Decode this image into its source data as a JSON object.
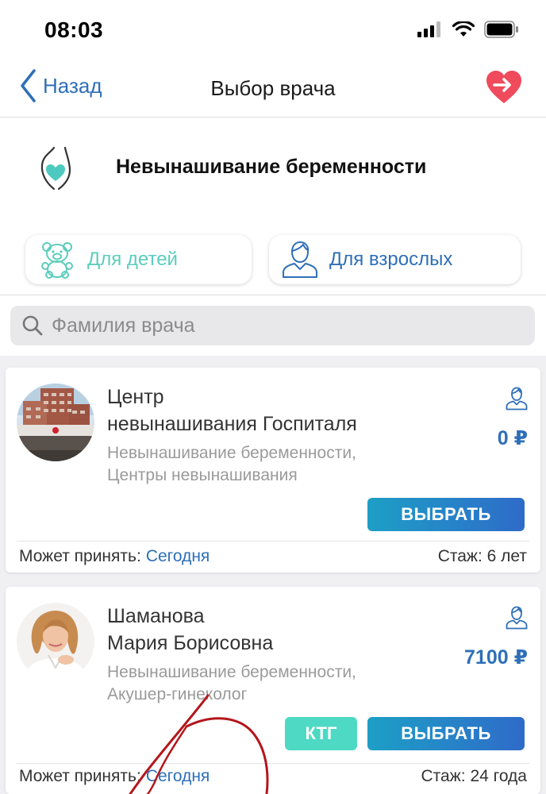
{
  "status_bar": {
    "time": "08:03",
    "icons": [
      "signal-icon",
      "wifi-icon",
      "battery-icon"
    ]
  },
  "nav": {
    "back_label": "Назад",
    "title": "Выбор врача",
    "favorite_icon": "heart-arrow-icon"
  },
  "specialty": {
    "icon": "pregnancy-icon",
    "title": "Невынашивание беременности"
  },
  "segments": {
    "kids_label": "Для детей",
    "kids_icon": "teddy-bear-icon",
    "adults_label": "Для взрослых",
    "adults_icon": "adult-person-icon"
  },
  "search": {
    "placeholder": "Фамилия врача",
    "value": ""
  },
  "doctors": [
    {
      "name_line1": "Центр",
      "name_line2": "невынашивания Госпиталя",
      "spec_line1": "Невынашивание беременности,",
      "spec_line2": "Центры невынашивания",
      "price": "0 ₽",
      "choose_label": "ВЫБРАТЬ",
      "accept_label": "Может принять:",
      "accept_value": "Сегодня",
      "experience": "Стаж: 6 лет"
    },
    {
      "name_line1": "Шаманова",
      "name_line2": "Мария Борисовна",
      "spec_line1": "Невынашивание беременности,",
      "spec_line2": "Акушер-гинеколог",
      "price": "7100 ₽",
      "extra_label": "КТГ",
      "choose_label": "ВЫБРАТЬ",
      "accept_label": "Может принять:",
      "accept_value": "Сегодня",
      "experience": "Стаж: 24 года"
    }
  ],
  "colors": {
    "accent_blue": "#2e6fb8",
    "accent_teal": "#5ccdbd",
    "button_gradient_start": "#1d9fc6",
    "button_gradient_end": "#2f6bc9",
    "ktg_button": "#4dd9c3",
    "favorite_red": "#ef4b5c",
    "scribble_red": "#b3161b"
  }
}
